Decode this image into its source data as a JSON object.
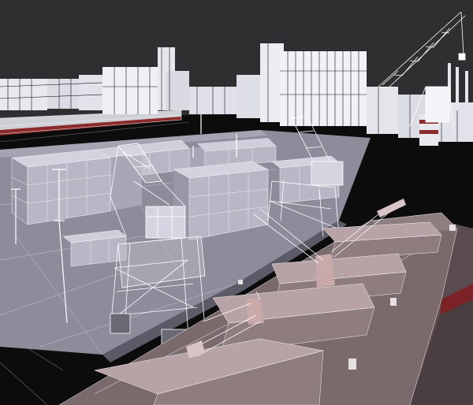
{
  "scene": {
    "subject": "wireframe-port-render",
    "colors": {
      "sky": "#2f2f31",
      "water": "#0c0c0d",
      "water_lines": "#6f6f75",
      "quay": "#8e8c9a",
      "quay_light": "#a6a4b2",
      "container": "#b9b7c5",
      "container_dark": "#9997a6",
      "wire": "#ffffff",
      "hull": "#7a6a6c",
      "hull_dark": "#5a4c4e",
      "deck": "#a89898",
      "hatch": "#b7a3a5",
      "stripe": "#8a2a2a"
    }
  }
}
